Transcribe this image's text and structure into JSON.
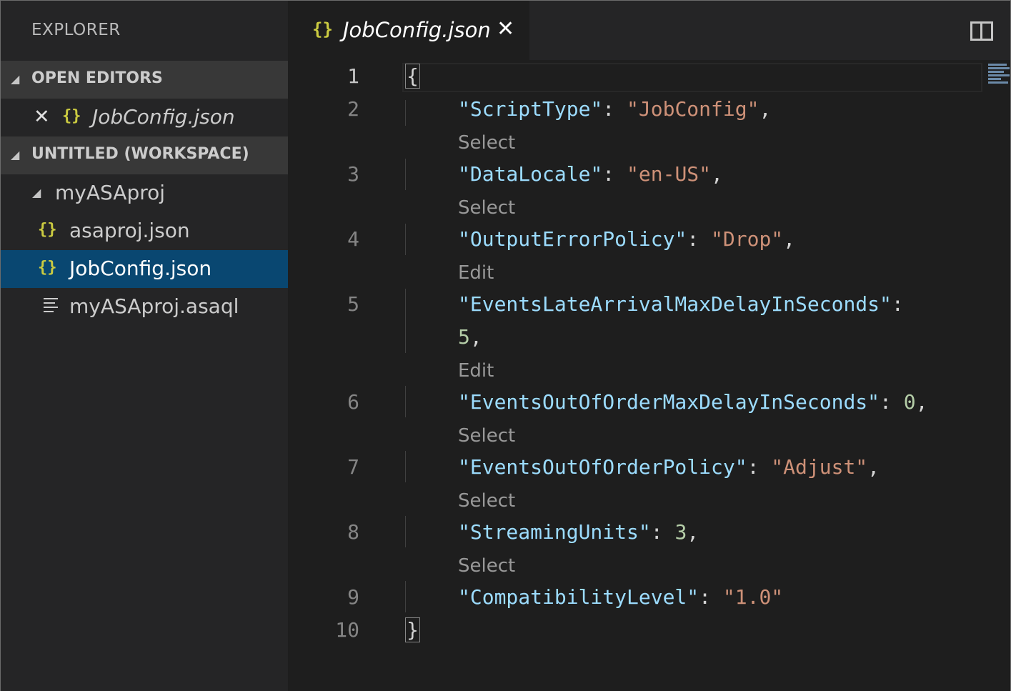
{
  "sidebar": {
    "title": "EXPLORER",
    "open_editors": {
      "header": "OPEN EDITORS",
      "items": [
        {
          "label": "JobConfig.json",
          "icon": "json-braces-icon"
        }
      ]
    },
    "workspace": {
      "header": "UNTITLED (WORKSPACE)",
      "folder": "myASAproj",
      "files": [
        {
          "label": "asaproj.json",
          "icon": "json-braces-icon",
          "selected": false
        },
        {
          "label": "JobConfig.json",
          "icon": "json-braces-icon",
          "selected": true
        },
        {
          "label": "myASAproj.asaql",
          "icon": "text-lines-icon",
          "selected": false
        }
      ]
    }
  },
  "editor": {
    "tab": {
      "label": "JobConfig.json",
      "icon_text": "{}",
      "close_glyph": "✕"
    },
    "icons": {
      "brace_icon": "{}",
      "close": "✕",
      "collapse": "◢"
    },
    "line_numbers": [
      "1",
      "2",
      "3",
      "4",
      "5",
      "6",
      "7",
      "8",
      "9",
      "10"
    ],
    "brace_open": "{",
    "brace_close": "}",
    "lines": [
      {
        "key": "\"ScriptType\"",
        "value": "\"JobConfig\"",
        "value_type": "string",
        "suffix": ","
      },
      {
        "key": "\"DataLocale\"",
        "value": "\"en-US\"",
        "value_type": "string",
        "suffix": ","
      },
      {
        "key": "\"OutputErrorPolicy\"",
        "value": "\"Drop\"",
        "value_type": "string",
        "suffix": ","
      },
      {
        "key": "\"EventsLateArrivalMaxDelayInSeconds\"",
        "value": "5",
        "value_type": "number",
        "suffix": ","
      },
      {
        "key": "\"EventsOutOfOrderMaxDelayInSeconds\"",
        "value": "0",
        "value_type": "number",
        "suffix": ","
      },
      {
        "key": "\"EventsOutOfOrderPolicy\"",
        "value": "\"Adjust\"",
        "value_type": "string",
        "suffix": ","
      },
      {
        "key": "\"StreamingUnits\"",
        "value": "3",
        "value_type": "number",
        "suffix": ","
      },
      {
        "key": "\"CompatibilityLevel\"",
        "value": "\"1.0\"",
        "value_type": "string",
        "suffix": ""
      }
    ],
    "codelens": [
      "Select",
      "Select",
      "Edit",
      "Edit",
      "Select",
      "Select",
      "Select"
    ],
    "colon": ":"
  },
  "colors": {
    "key": "#9cdcfe",
    "string": "#ce9178",
    "number": "#b5cea8",
    "selected_row": "#094771",
    "json_icon": "#cbcb41"
  }
}
